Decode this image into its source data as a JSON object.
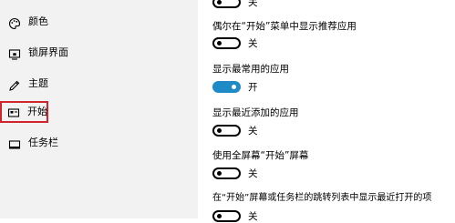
{
  "sidebar": {
    "items": [
      {
        "icon": "palette-icon",
        "label": "颜色"
      },
      {
        "icon": "lock-screen-icon",
        "label": "锁屏界面"
      },
      {
        "icon": "theme-icon",
        "label": "主题"
      },
      {
        "icon": "start-icon",
        "label": "开始"
      },
      {
        "icon": "taskbar-icon",
        "label": "任务栏"
      }
    ],
    "selected": "开始"
  },
  "settings": [
    {
      "label": "",
      "state": "关",
      "on": false
    },
    {
      "label": "偶尔在“开始”菜单中显示推荐应用",
      "state": "关",
      "on": false
    },
    {
      "label": "显示最常用的应用",
      "state": "开",
      "on": true
    },
    {
      "label": "显示最近添加的应用",
      "state": "关",
      "on": false
    },
    {
      "label": "使用全屏幕“开始”屏幕",
      "state": "关",
      "on": false
    },
    {
      "label": "在“开始”屏幕或任务栏的跳转列表中显示最近打开的项",
      "state": "关",
      "on": false
    }
  ],
  "colors": {
    "accent": "#1e8bc7",
    "highlight_box": "#d2242c"
  }
}
